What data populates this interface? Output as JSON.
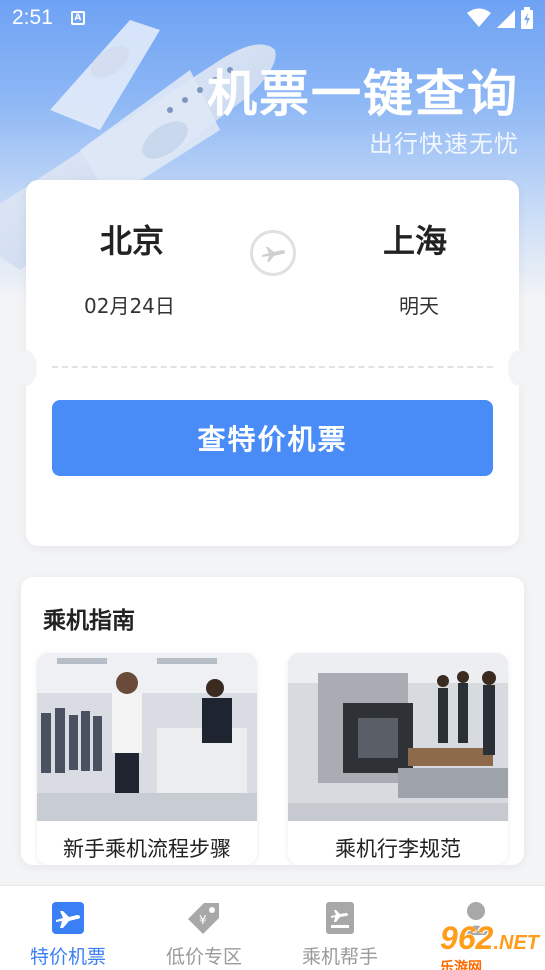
{
  "status_bar": {
    "time": "2:51",
    "indicator": "A"
  },
  "header": {
    "title": "机票一键查询",
    "subtitle": "出行快速无忧"
  },
  "search": {
    "from_city": "北京",
    "to_city": "上海",
    "from_date": "02月24日",
    "to_date": "明天",
    "button_label": "查特价机票"
  },
  "guide": {
    "title": "乘机指南",
    "items": [
      {
        "label": "新手乘机流程步骤"
      },
      {
        "label": "乘机行李规范"
      }
    ]
  },
  "bottom_nav": {
    "items": [
      {
        "label": "特价机票",
        "active": true
      },
      {
        "label": "低价专区",
        "active": false
      },
      {
        "label": "乘机帮手",
        "active": false
      },
      {
        "label": "",
        "active": false
      }
    ]
  },
  "watermark": {
    "text": "962",
    "suffix": ".NET",
    "sub": "乐游网"
  },
  "colors": {
    "accent": "#4a8cf7",
    "active_nav": "#3b7ff5",
    "inactive_nav": "#9a9a9a"
  }
}
